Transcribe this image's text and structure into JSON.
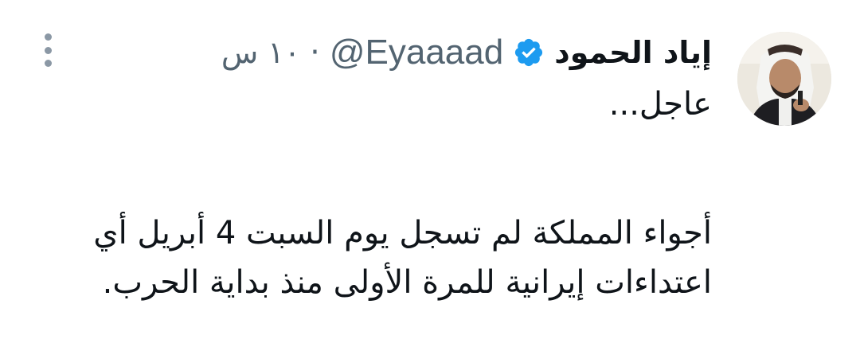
{
  "tweet": {
    "author": {
      "display_name": "إياد الحمود",
      "handle": "@Eyaaaad",
      "verified": true,
      "avatar_icon": "profile-photo"
    },
    "separator": "·",
    "time": "١٠ س",
    "menu_icon": "more-vertical-icon",
    "body": {
      "line1": "عاجل...",
      "line2": "أجواء المملكة لم تسجل يوم السبت 4 أبريل أي",
      "line3": "اعتداءات إيرانية للمرة الأولى منذ بداية الحرب."
    },
    "colors": {
      "verified_badge": "#1d9bf0",
      "secondary_text": "#536471",
      "primary_text": "#0f1419"
    }
  }
}
